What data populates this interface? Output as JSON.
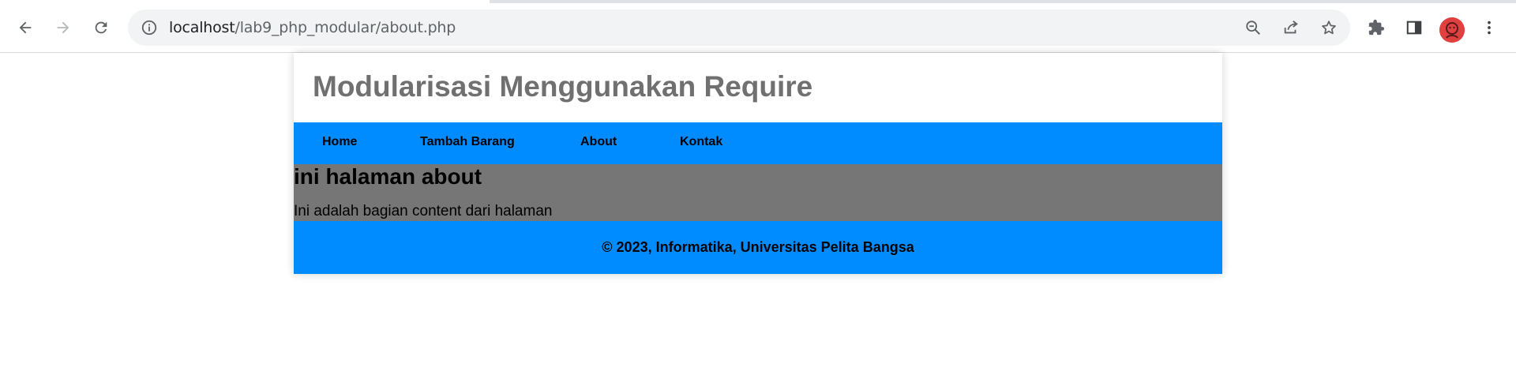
{
  "browser": {
    "url_host": "localhost",
    "url_path": "/lab9_php_modular/about.php",
    "icons": {
      "back": "back-arrow-icon",
      "forward": "forward-arrow-icon",
      "reload": "reload-icon",
      "site_info": "info-icon",
      "zoom": "zoom-out-icon",
      "share": "share-icon",
      "bookmark": "star-icon",
      "extensions": "puzzle-icon",
      "side_panel": "side-panel-icon",
      "profile": "avatar",
      "menu": "kebab-menu-icon"
    }
  },
  "site": {
    "title": "Modularisasi Menggunakan Require",
    "nav": [
      {
        "label": "Home"
      },
      {
        "label": "Tambah Barang"
      },
      {
        "label": "About"
      },
      {
        "label": "Kontak"
      }
    ],
    "content": {
      "heading": "ini halaman about",
      "text": "Ini adalah bagian content dari halaman"
    },
    "footer": "© 2023, Informatika, Universitas Pelita Bangsa"
  },
  "colors": {
    "nav_bg": "#008cff",
    "content_bg": "#767676",
    "title_color": "#707070",
    "omnibox_bg": "#f1f3f4"
  }
}
